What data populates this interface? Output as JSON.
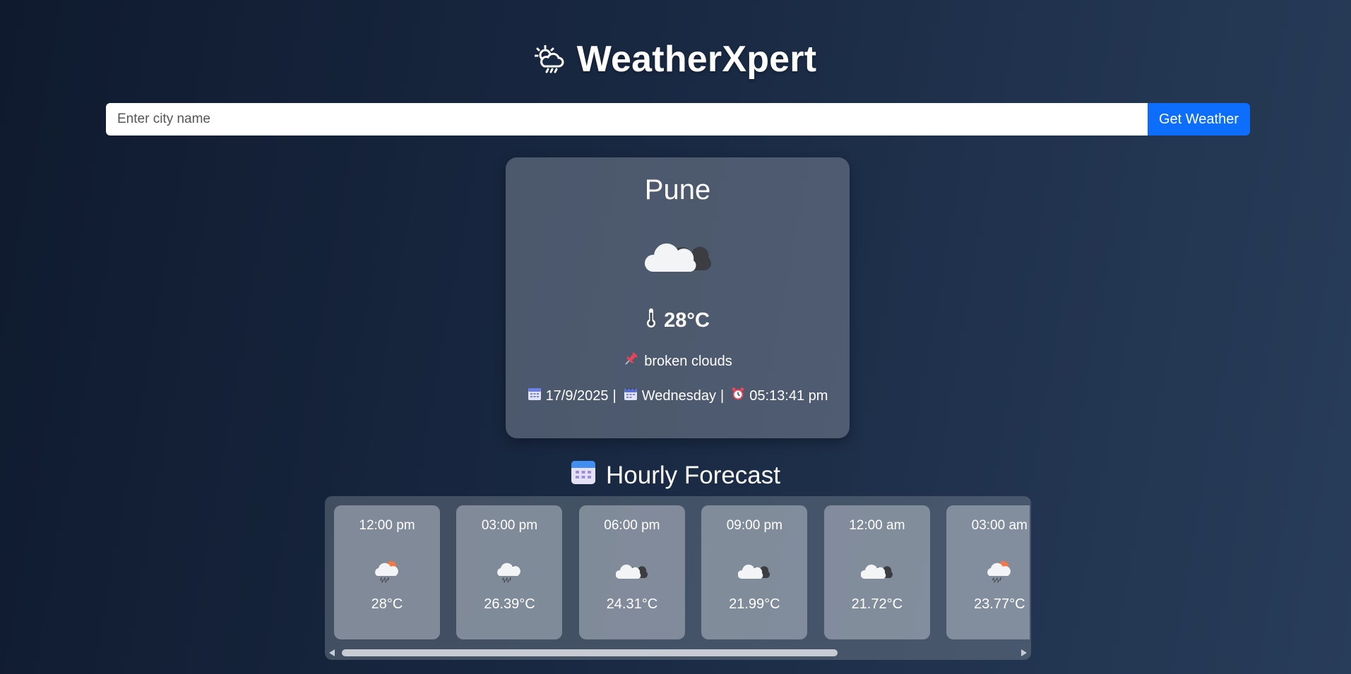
{
  "header": {
    "title": "WeatherXpert",
    "icon": "cloud-sun-rain-icon"
  },
  "search": {
    "placeholder": "Enter city name",
    "value": "",
    "button_label": "Get Weather"
  },
  "current": {
    "city": "Pune",
    "icon": "broken-clouds-icon",
    "temperature": "28°C",
    "description": "broken clouds",
    "date": "17/9/2025",
    "day": "Wednesday",
    "time": "05:13:41 pm",
    "separator": "|"
  },
  "hourly": {
    "heading": "Hourly Forecast",
    "items": [
      {
        "time": "12:00 pm",
        "temp": "28°C",
        "icon": "sun-rain-icon"
      },
      {
        "time": "03:00 pm",
        "temp": "26.39°C",
        "icon": "cloud-rain-icon"
      },
      {
        "time": "06:00 pm",
        "temp": "24.31°C",
        "icon": "broken-clouds-icon"
      },
      {
        "time": "09:00 pm",
        "temp": "21.99°C",
        "icon": "broken-clouds-icon"
      },
      {
        "time": "12:00 am",
        "temp": "21.72°C",
        "icon": "broken-clouds-icon"
      },
      {
        "time": "03:00 am",
        "temp": "23.77°C",
        "icon": "sun-rain-icon"
      }
    ]
  },
  "colors": {
    "accent": "#0d6efd",
    "background_start": "#0f1a2e",
    "background_end": "#283d5a"
  }
}
